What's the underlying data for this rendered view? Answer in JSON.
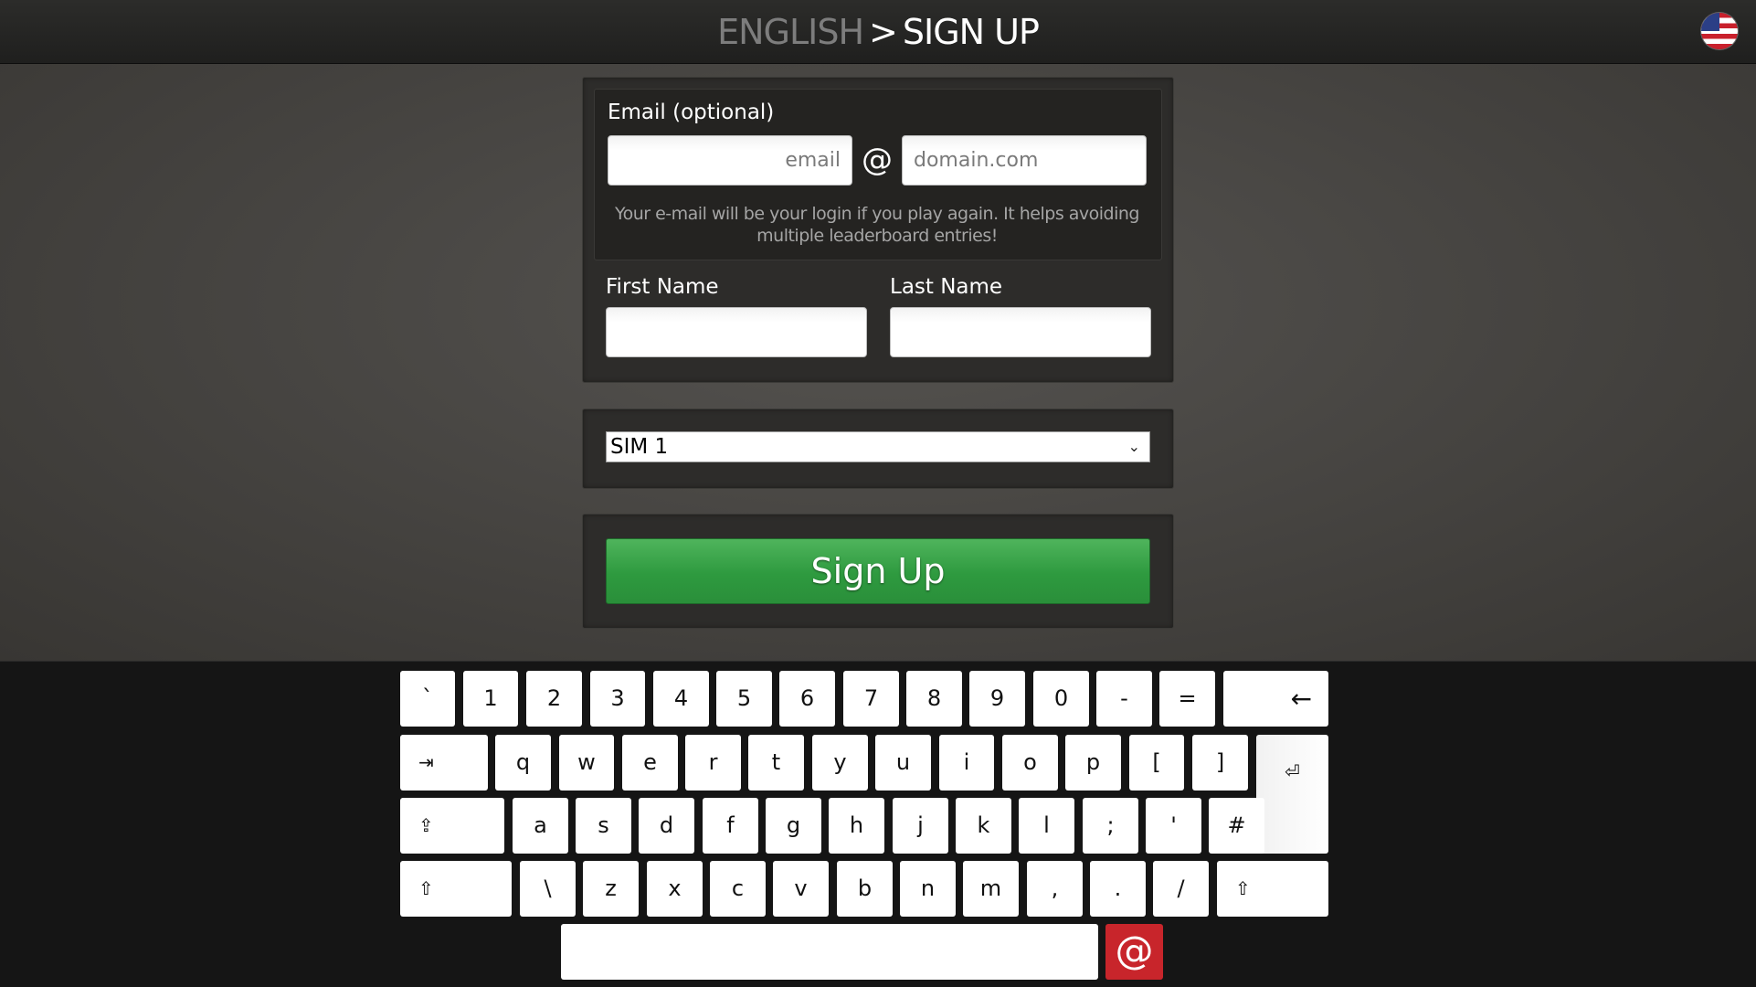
{
  "header": {
    "language": "ENGLISH",
    "separator": ">",
    "page_title": "SIGN UP",
    "flag_icon": "us-flag-icon"
  },
  "form": {
    "email_label": "Email (optional)",
    "email_user_placeholder": "email",
    "email_at": "@",
    "email_domain_placeholder": "domain.com",
    "email_hint": "Your e-mail will be your login if you play again. It helps avoiding multiple leaderboard entries!",
    "first_name_label": "First Name",
    "first_name_value": "",
    "last_name_label": "Last Name",
    "last_name_value": ""
  },
  "sim_select": {
    "selected": "SIM 1"
  },
  "submit": {
    "label": "Sign Up",
    "color": "#37a547"
  },
  "keyboard": {
    "row1": [
      "`",
      "1",
      "2",
      "3",
      "4",
      "5",
      "6",
      "7",
      "8",
      "9",
      "0",
      "-",
      "="
    ],
    "backspace": "←",
    "tab": "⇥",
    "row2": [
      "q",
      "w",
      "e",
      "r",
      "t",
      "y",
      "u",
      "i",
      "o",
      "p",
      "[",
      "]"
    ],
    "enter": "⏎",
    "caps": "⇪",
    "row3": [
      "a",
      "s",
      "d",
      "f",
      "g",
      "h",
      "j",
      "k",
      "l",
      ";",
      "'",
      "#"
    ],
    "shift": "⇧",
    "row4": [
      "\\",
      "z",
      "x",
      "c",
      "v",
      "b",
      "n",
      "m",
      ",",
      ".",
      "/"
    ],
    "space": "",
    "at": "@",
    "at_color": "#c8252b"
  }
}
